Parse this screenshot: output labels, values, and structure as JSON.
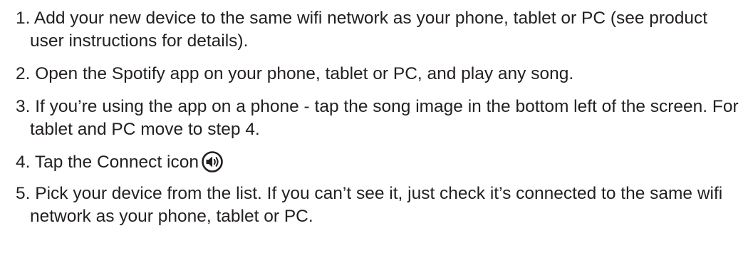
{
  "steps": [
    {
      "number": "1.",
      "text": "Add your new device to the same wifi network as your phone, tablet or PC (see product user instructions for details)."
    },
    {
      "number": "2.",
      "text": "Open the Spotify app on your phone, tablet or PC, and play any song."
    },
    {
      "number": "3.",
      "text": "If you’re using the app on a phone - tap the song image in the bottom left of the screen. For tablet and PC move to step 4."
    },
    {
      "number": "4.",
      "text": "Tap the Connect icon",
      "icon": "speaker-connect-icon"
    },
    {
      "number": "5.",
      "text": "Pick your device from the list. If you can’t see it, just check it’s connected to the same wifi network as your phone, tablet or PC."
    }
  ],
  "colors": {
    "text": "#231f20",
    "background": "#ffffff"
  }
}
